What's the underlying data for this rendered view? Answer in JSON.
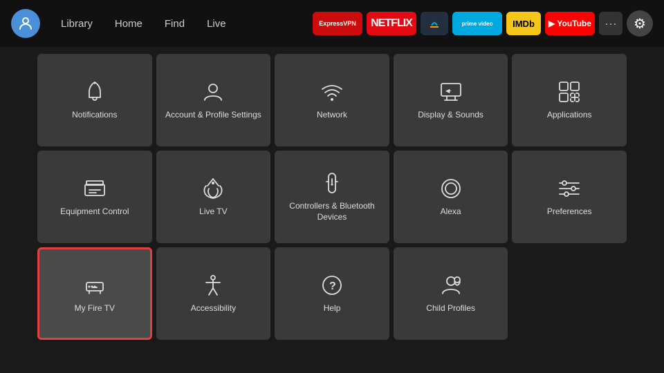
{
  "nav": {
    "links": [
      "Library",
      "Home",
      "Find",
      "Live"
    ],
    "active": "Home"
  },
  "apps": [
    {
      "label": "ExpressVPN",
      "class": "app-express",
      "text": "Express VPN"
    },
    {
      "label": "Netflix",
      "class": "app-netflix",
      "text": "NETFLIX"
    },
    {
      "label": "Amazon Music",
      "class": "app-amazon-music",
      "text": "♪"
    },
    {
      "label": "Prime Video",
      "class": "app-prime",
      "text": "prime video"
    },
    {
      "label": "IMDb TV",
      "class": "app-imdb",
      "text": "IMDb"
    },
    {
      "label": "YouTube",
      "class": "app-youtube",
      "text": "▶ YouTube"
    }
  ],
  "grid": {
    "row1": [
      {
        "id": "notifications",
        "label": "Notifications",
        "icon": "bell"
      },
      {
        "id": "account-profile",
        "label": "Account & Profile Settings",
        "icon": "person"
      },
      {
        "id": "network",
        "label": "Network",
        "icon": "wifi"
      },
      {
        "id": "display-sounds",
        "label": "Display & Sounds",
        "icon": "display"
      },
      {
        "id": "applications",
        "label": "Applications",
        "icon": "apps"
      }
    ],
    "row2": [
      {
        "id": "equipment-control",
        "label": "Equipment Control",
        "icon": "tv"
      },
      {
        "id": "live-tv",
        "label": "Live TV",
        "icon": "antenna"
      },
      {
        "id": "controllers-bluetooth",
        "label": "Controllers & Bluetooth Devices",
        "icon": "remote"
      },
      {
        "id": "alexa",
        "label": "Alexa",
        "icon": "alexa"
      },
      {
        "id": "preferences",
        "label": "Preferences",
        "icon": "sliders"
      }
    ],
    "row3": [
      {
        "id": "my-fire-tv",
        "label": "My Fire TV",
        "icon": "firetv",
        "selected": true
      },
      {
        "id": "accessibility",
        "label": "Accessibility",
        "icon": "accessibility"
      },
      {
        "id": "help",
        "label": "Help",
        "icon": "help"
      },
      {
        "id": "child-profiles",
        "label": "Child Profiles",
        "icon": "child"
      }
    ]
  }
}
